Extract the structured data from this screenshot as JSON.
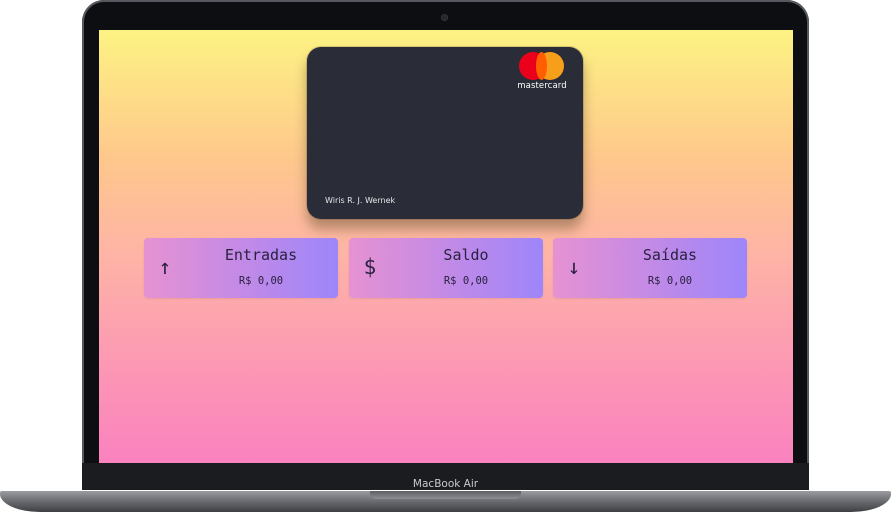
{
  "card": {
    "brand": "mastercard",
    "holder": "Wiris R. J. Wernek",
    "colors": {
      "card_bg": "#2a2d37",
      "brand_red": "#eb001b",
      "brand_orange": "#f79e1b"
    }
  },
  "summary": [
    {
      "icon": "arrow-up-icon",
      "glyph": "↑",
      "title": "Entradas",
      "value": "R$ 0,00"
    },
    {
      "icon": "dollar-icon",
      "glyph": "$",
      "title": "Saldo",
      "value": "R$ 0,00"
    },
    {
      "icon": "arrow-down-icon",
      "glyph": "↓",
      "title": "Saídas",
      "value": "R$ 0,00"
    }
  ],
  "device": {
    "model": "MacBook Air"
  },
  "colors": {
    "screen_gradient_top": "#fdf383",
    "screen_gradient_bottom": "#fa82bf",
    "tile_gradient_left": "#e692d2",
    "tile_gradient_right": "#9d86fa"
  }
}
